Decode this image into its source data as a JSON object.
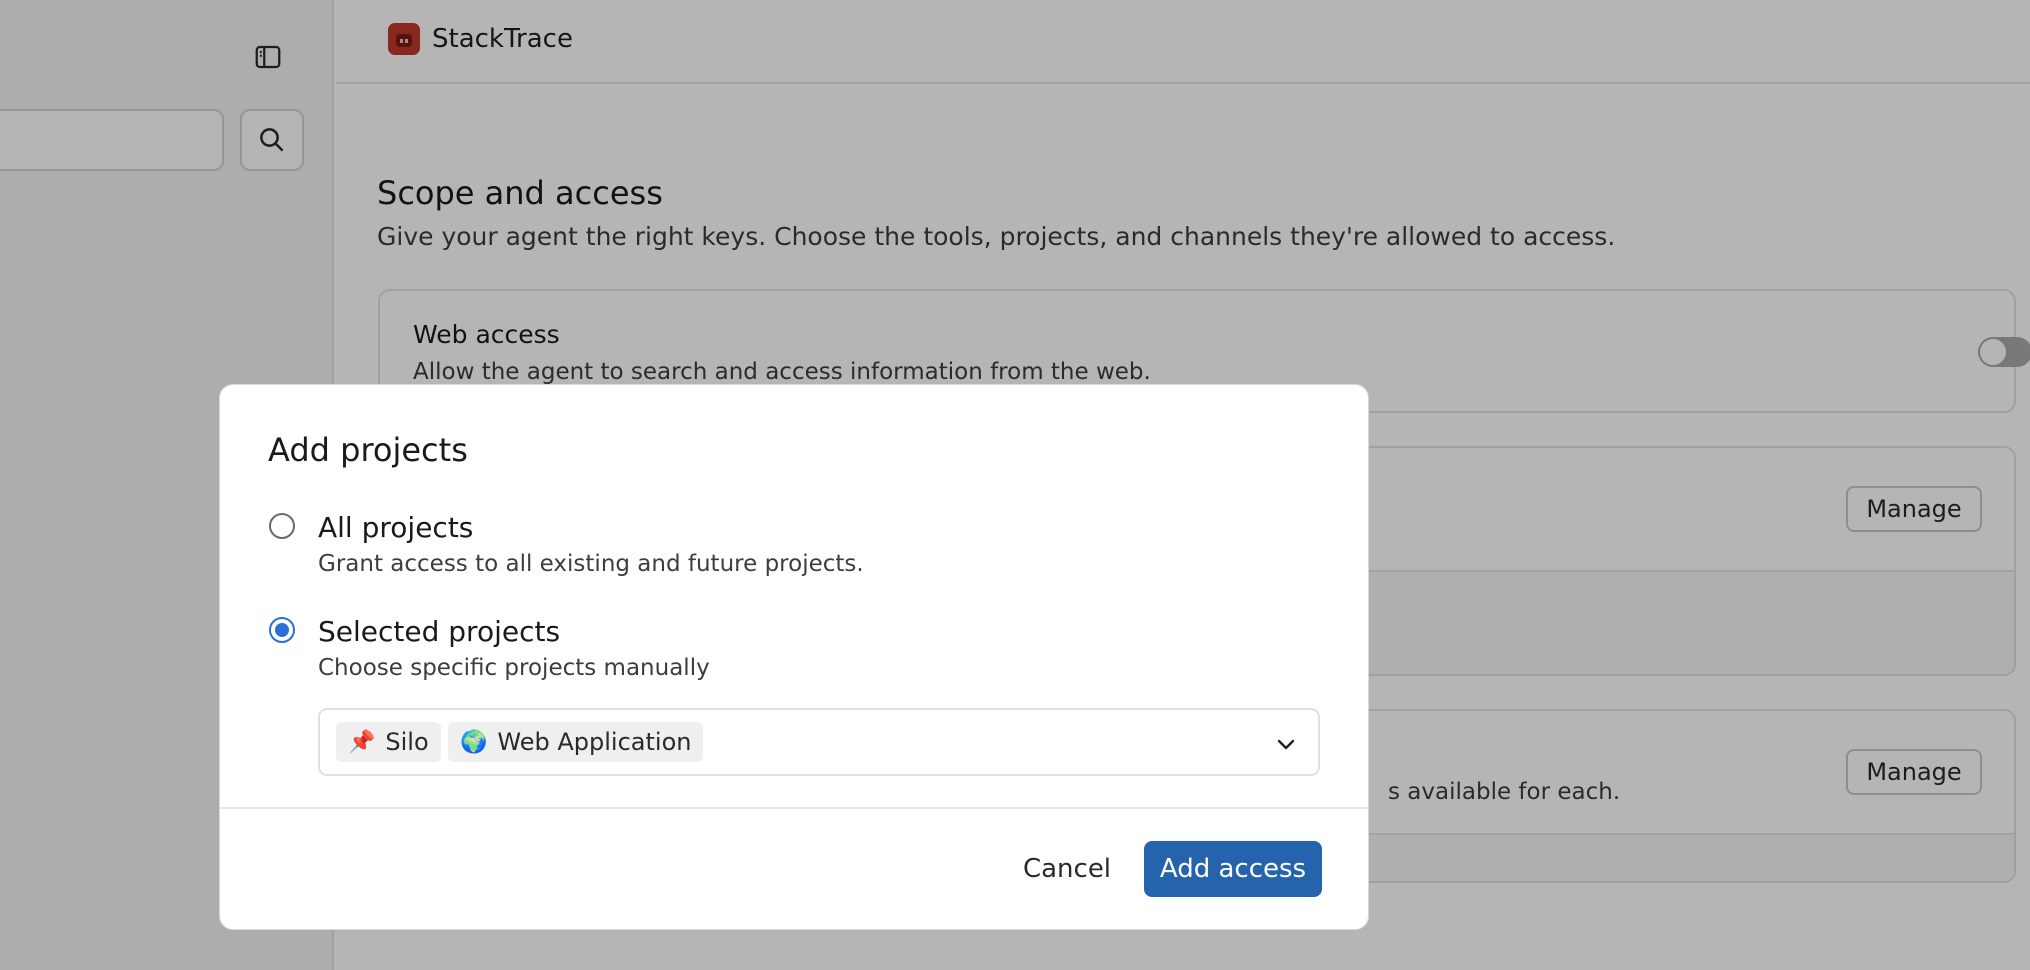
{
  "app": {
    "name": "StackTrace",
    "logo_icon": "stacktrace-logo-icon",
    "brand_color": "#c2392b"
  },
  "sidebar": {
    "toggle_icon": "sidebar-panel-icon",
    "search_icon": "search-icon"
  },
  "main": {
    "section_title": "Scope and access",
    "section_description": "Give your agent the right keys. Choose the tools, projects, and channels they're allowed to access.",
    "web_access": {
      "title": "Web access",
      "description": "Allow the agent to search and access information from the web.",
      "enabled": false
    },
    "projects_card": {
      "manage_label": "Manage"
    },
    "channels_card": {
      "description_visible": "s available for each.",
      "manage_label": "Manage"
    }
  },
  "dialog": {
    "title": "Add projects",
    "options": [
      {
        "label": "All projects",
        "description": "Grant access to all existing and future projects.",
        "selected": false
      },
      {
        "label": "Selected projects",
        "description": "Choose specific projects manually",
        "selected": true
      }
    ],
    "selected_projects": [
      {
        "emoji": "📌",
        "name": "Silo"
      },
      {
        "emoji": "🌍",
        "name": "Web Application"
      }
    ],
    "dropdown_icon": "chevron-down-icon",
    "cancel_label": "Cancel",
    "submit_label": "Add access",
    "accent_color": "#2663ad",
    "radio_color": "#2d6fd8"
  }
}
